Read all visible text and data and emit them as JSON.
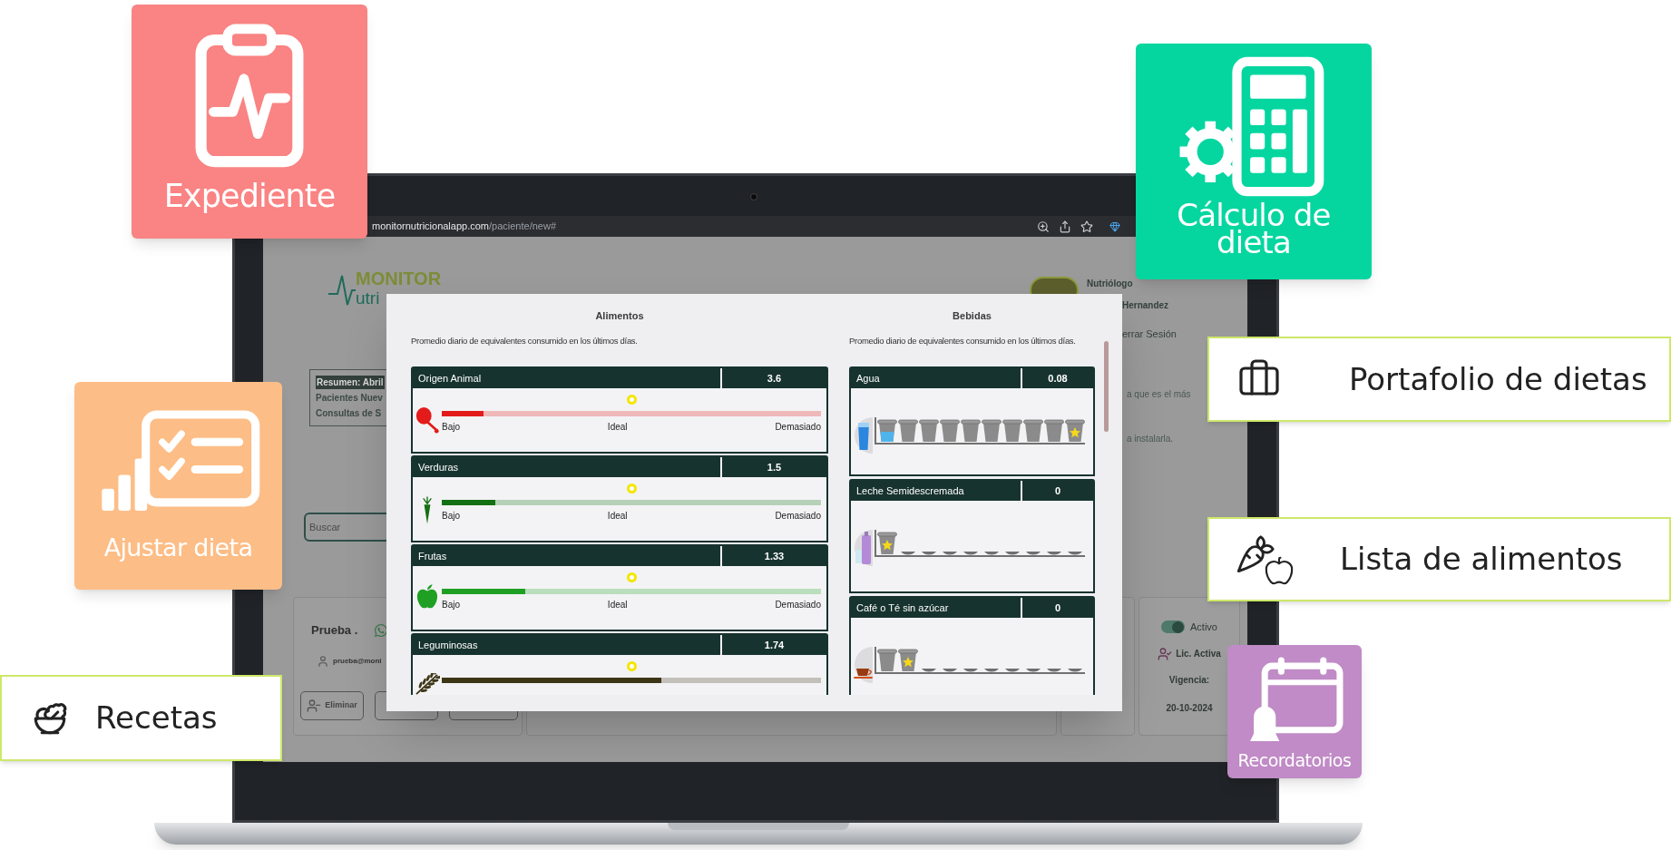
{
  "feature_badges": [
    {
      "kind": "tile",
      "label": "Expediente",
      "color": "#fa8383"
    },
    {
      "kind": "tile",
      "label": "Cálculo de dieta",
      "color": "#05d6a0"
    },
    {
      "kind": "strip",
      "label": "Portafolio de dietas"
    },
    {
      "kind": "tile",
      "label": "Ajustar dieta",
      "color": "#fdbd86"
    },
    {
      "kind": "strip",
      "label": "Lista de alimentos"
    },
    {
      "kind": "tile",
      "label": "Recordatorios",
      "color": "#c08bc6"
    },
    {
      "kind": "strip",
      "label": "Recetas"
    }
  ],
  "browser": {
    "domain": "monitornutricionalapp.com",
    "path": "/paciente/new#"
  },
  "app": {
    "logo": {
      "line1": "MONITOR",
      "line2": "utri"
    },
    "summary": {
      "title": "Resumen: Abril",
      "lines": [
        "Pacientes Nuev",
        "Consultas de S"
      ]
    },
    "search": {
      "placeholder": "Buscar"
    },
    "user": {
      "role": "Nutriólogo",
      "name": "Hernandez",
      "logout": "errar Sesión"
    },
    "notice": [
      "a que es el más",
      "a instalarla."
    ],
    "patient": {
      "name": "Prueba .",
      "email": "prueba@moni",
      "delete_button": "Eliminar"
    },
    "license": {
      "toggle": {
        "label": "Activo",
        "on": true
      },
      "status": "Lic. Activa",
      "validity_label": "Vigencia:",
      "validity_date": "20-10-2024"
    }
  },
  "modal": {
    "foods": {
      "title": "Alimentos",
      "subtitle": "Promedio diario de equivalentes consumido en los últimos días.",
      "items": [
        {
          "kind": "meat",
          "name": "Origen Animal",
          "value": "3.6",
          "level": 0.11,
          "color": "#e31b1b",
          "scale": [
            "Bajo",
            "Ideal",
            "Demasiado"
          ]
        },
        {
          "kind": "vegetable",
          "name": "Verduras",
          "value": "1.5",
          "level": 0.14,
          "color": "#137013",
          "scale": [
            "Bajo",
            "Ideal",
            "Demasiado"
          ]
        },
        {
          "kind": "fruit",
          "name": "Frutas",
          "value": "1.33",
          "level": 0.22,
          "color": "#1fa024",
          "scale": [
            "Bajo",
            "Ideal",
            "Demasiado"
          ]
        },
        {
          "kind": "legume",
          "name": "Leguminosas",
          "value": "1.74",
          "level": 0.58,
          "color": "#3d3616"
        }
      ]
    },
    "drinks": {
      "title": "Bebidas",
      "subtitle": "Promedio diario de equivalentes consumido en los últimos días.",
      "items": [
        {
          "kind": "water",
          "name": "Agua",
          "value": "0.08",
          "slots": [
            {
              "kind": "water"
            },
            {
              "kind": "cup"
            },
            {
              "kind": "cup"
            },
            {
              "kind": "cup"
            },
            {
              "kind": "cup"
            },
            {
              "kind": "cup"
            },
            {
              "kind": "cup"
            },
            {
              "kind": "cup"
            },
            {
              "kind": "cup"
            },
            {
              "kind": "goal"
            }
          ]
        },
        {
          "kind": "milk",
          "name": "Leche Semidescremada",
          "value": "0",
          "slots": [
            {
              "kind": "goal"
            },
            {
              "kind": "plate"
            },
            {
              "kind": "plate"
            },
            {
              "kind": "plate"
            },
            {
              "kind": "plate"
            },
            {
              "kind": "plate"
            },
            {
              "kind": "plate"
            },
            {
              "kind": "plate"
            },
            {
              "kind": "plate"
            },
            {
              "kind": "plate"
            }
          ]
        },
        {
          "kind": "coffee",
          "name": "Café o Té sin azúcar",
          "value": "0",
          "slots": [
            {
              "kind": "cup"
            },
            {
              "kind": "goal"
            },
            {
              "kind": "plate"
            },
            {
              "kind": "plate"
            },
            {
              "kind": "plate"
            },
            {
              "kind": "plate"
            },
            {
              "kind": "plate"
            },
            {
              "kind": "plate"
            },
            {
              "kind": "plate"
            },
            {
              "kind": "plate"
            }
          ]
        }
      ]
    }
  }
}
